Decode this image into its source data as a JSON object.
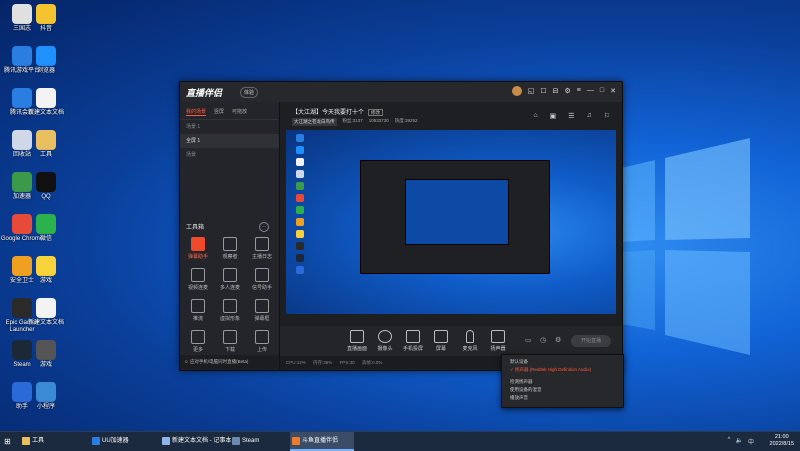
{
  "desktop": {
    "icons": [
      {
        "label": "三国志",
        "color": "#e0e0e0"
      },
      {
        "label": "抖音",
        "color": "#f4c430"
      },
      {
        "label": "腾讯游戏平台",
        "color": "#2a7de1"
      },
      {
        "label": "浏览器",
        "color": "#1e90ff"
      },
      {
        "label": "腾讯会议",
        "color": "#2a7de1"
      },
      {
        "label": "新建文本文档",
        "color": "#f3f3f3"
      },
      {
        "label": "回收站",
        "color": "#d0d8e8"
      },
      {
        "label": "工具",
        "color": "#e8c060"
      },
      {
        "label": "加速器",
        "color": "#3a9a4a"
      },
      {
        "label": "QQ",
        "color": "#111111"
      },
      {
        "label": "Google Chrome",
        "color": "#e84a3a"
      },
      {
        "label": "微信",
        "color": "#2bb24c"
      },
      {
        "label": "安全卫士",
        "color": "#f0a020"
      },
      {
        "label": "游戏",
        "color": "#f7d23a"
      },
      {
        "label": "Epic Games Launcher",
        "color": "#2a2a2a"
      },
      {
        "label": "新建文本文档",
        "color": "#f3f3f3"
      },
      {
        "label": "Steam",
        "color": "#1b2838"
      },
      {
        "label": "游戏",
        "color": "#555555"
      },
      {
        "label": "助手",
        "color": "#2a6ad8"
      },
      {
        "label": "小程序",
        "color": "#3a8ad8"
      }
    ]
  },
  "app": {
    "logo": "直播伴侣",
    "badge": "体验",
    "titlebar_icons": [
      "◱",
      "☐",
      "⊟",
      "⚙",
      "≡",
      "—",
      "□",
      "✕"
    ],
    "left_tabs": [
      "我的场景",
      "竖屏",
      "可拖放"
    ],
    "scenes": [
      {
        "label": "场景 1",
        "active": false
      },
      {
        "label": "全屏 1",
        "active": true
      },
      {
        "label": "场景",
        "active": false
      }
    ],
    "tools_title": "工具箱",
    "tools_more": "···",
    "tools": [
      {
        "label": "弹幕助手",
        "highlight": true
      },
      {
        "label": "观察者",
        "highlight": false
      },
      {
        "label": "主播日志",
        "highlight": false
      },
      {
        "label": "视频连麦",
        "highlight": false
      },
      {
        "label": "多人连麦",
        "highlight": false
      },
      {
        "label": "信号助手",
        "highlight": false
      },
      {
        "label": "推流",
        "highlight": false
      },
      {
        "label": "虚拟形象",
        "highlight": false
      },
      {
        "label": "弹幕框",
        "highlight": false
      },
      {
        "label": "更多",
        "highlight": false
      },
      {
        "label": "下载",
        "highlight": false
      },
      {
        "label": "上传",
        "highlight": false
      }
    ],
    "left_footer": "☺ 应对手机/电脑同时直播(Beta)",
    "room_title": "【大江湖】今天我要打十个",
    "room_tag": "修改",
    "room_info": {
      "category": "大江湖之苍龙白鸟传",
      "fans": "粉丝:3137",
      "uid": "10533730",
      "hot": "热度:39252"
    },
    "main_icons": [
      "⌂",
      "▣",
      "☰",
      "♫",
      "⚐"
    ],
    "device_menu": {
      "items": [
        {
          "label": "默认设备",
          "selected": false
        },
        {
          "label": "扬声器 (Realtek High Definition Audio)",
          "selected": true
        },
        {
          "label": "",
          "selected": false
        },
        {
          "label": "检测扬声器",
          "selected": false
        },
        {
          "label": "使用设备的混音",
          "selected": false
        },
        {
          "label": "播放声音",
          "selected": false
        }
      ]
    },
    "bottom_buttons": [
      "直播画面",
      "摄像头",
      "手机投屏",
      "屏幕",
      "麦克风",
      "扬声器"
    ],
    "go_live": "开始直播",
    "status": [
      "CPU:12%",
      "内存:36%",
      "FPS:30",
      "丢帧:0.0%"
    ]
  },
  "taskbar": {
    "items": [
      {
        "label": "工具",
        "color": "#e8c060",
        "active": false
      },
      {
        "label": "UU加速器",
        "color": "#2a7de1",
        "active": false
      },
      {
        "label": "新建文本文档 - 记事本",
        "color": "#8fb4e8",
        "active": false
      },
      {
        "label": "Steam",
        "color": "#6a8ab0",
        "active": false
      },
      {
        "label": "斗鱼直播伴侣",
        "color": "#f07a2a",
        "active": true
      }
    ],
    "tray_icons": [
      "^",
      "🔈",
      "中"
    ],
    "time": "21:00",
    "date": "2022/8/15"
  }
}
